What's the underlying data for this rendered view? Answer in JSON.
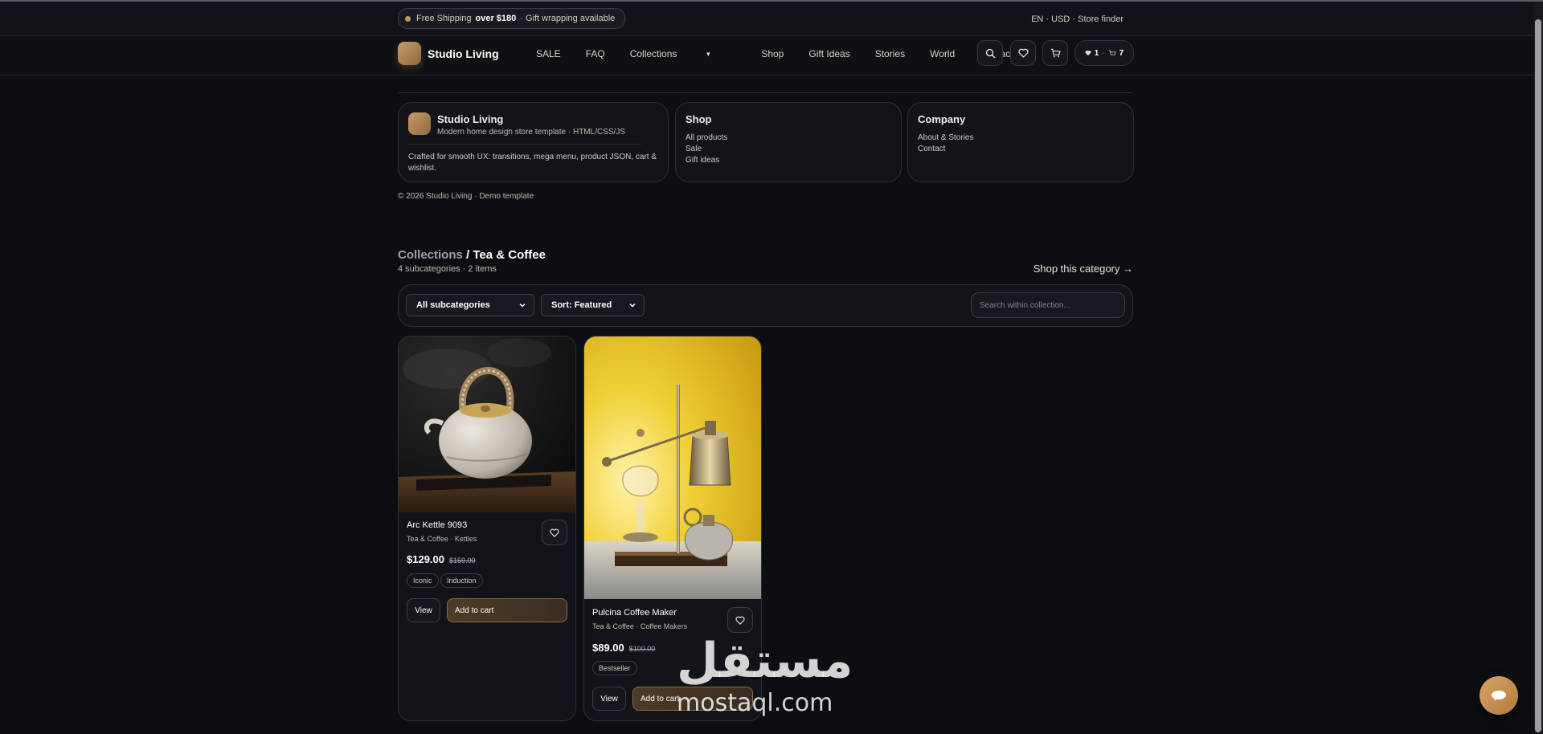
{
  "announcement": {
    "lead": "Free Shipping",
    "bold": "over $180",
    "tail": "· Gift wrapping available",
    "locale": "EN · USD · Store finder"
  },
  "nav": {
    "brand": "Studio Living",
    "links": [
      "SALE",
      "FAQ",
      "Collections",
      "Shop",
      "Gift Ideas",
      "Stories",
      "World",
      "Contact"
    ],
    "wishlist_count": "1",
    "cart_count": "7",
    "separator": "·"
  },
  "footer": {
    "brand_card": {
      "title": "Studio Living",
      "subtitle": "Modern home design store template · HTML/CSS/JS",
      "description": "Crafted for smooth UX: transitions, mega menu, product JSON, cart & wishlist."
    },
    "shop_card": {
      "title": "Shop",
      "links": [
        "All products",
        "Sale",
        "Gift ideas"
      ]
    },
    "company_card": {
      "title": "Company",
      "links": [
        "About & Stories",
        "Contact"
      ]
    },
    "copyright": "© 2026 Studio Living · Demo template"
  },
  "collection": {
    "crumb_parent": "Collections",
    "crumb_current": " / Tea & Coffee",
    "count": "4 subcategories · 2 items",
    "shop_link": "Shop this category →",
    "subcategory_select": "All subcategories",
    "sort_select": "Sort: Featured",
    "search_placeholder": "Search within collection..."
  },
  "products": [
    {
      "name": "Arc Kettle 9093",
      "category": "Tea & Coffee · Kettles",
      "price": "$129.00",
      "old_price": "$159.00",
      "tags": [
        "Iconic",
        "Induction"
      ],
      "view_label": "View",
      "cart_label": "Add to cart"
    },
    {
      "name": "Pulcina Coffee Maker",
      "category": "Tea & Coffee · Coffee Makers",
      "price": "$89.00",
      "old_price": "$100.00",
      "tags": [
        "Bestseller"
      ],
      "view_label": "View",
      "cart_label": "Add to cart"
    }
  ],
  "watermark": {
    "arabic": "مستقل",
    "latin": "mostaql.com"
  },
  "colors": {
    "background": "#0c0e12",
    "accent": "#c8965a",
    "card": "#121419"
  }
}
